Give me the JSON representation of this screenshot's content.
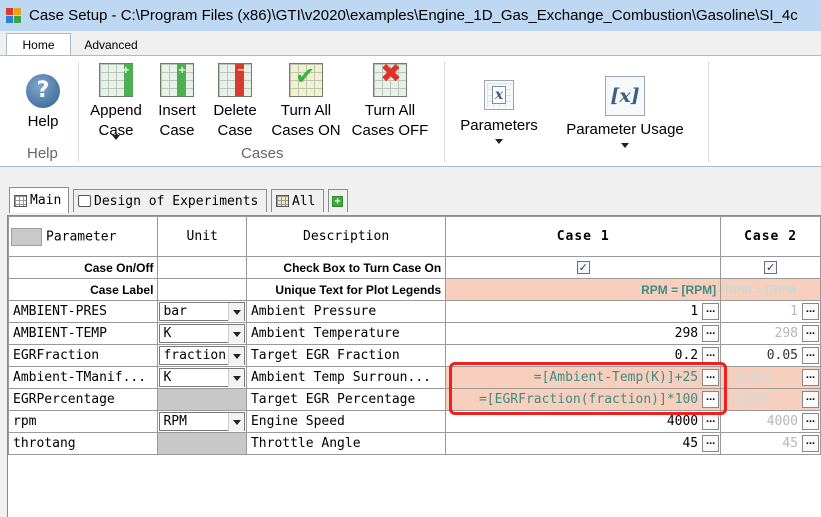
{
  "window": {
    "title": "Case Setup - C:\\Program Files (x86)\\GTI\\v2020\\examples\\Engine_1D_Gas_Exchange_Combustion\\Gasoline\\SI_4c"
  },
  "ribbon_tabs": [
    "Home",
    "Advanced"
  ],
  "ribbon": {
    "help": {
      "label": "Help",
      "group": "Help"
    },
    "cases_group": "Cases",
    "append_case": [
      "Append",
      "Case"
    ],
    "insert_case": [
      "Insert",
      "Case"
    ],
    "delete_case": [
      "Delete",
      "Case"
    ],
    "turn_all_on": [
      "Turn All",
      "Cases ON"
    ],
    "turn_all_off": [
      "Turn All",
      "Cases OFF"
    ],
    "parameters": "Parameters",
    "parameter_usage": "Parameter Usage"
  },
  "sheet_tabs": [
    "Main",
    "Design of Experiments",
    "All"
  ],
  "grid": {
    "headers": {
      "parameter": "Parameter",
      "unit": "Unit",
      "description": "Description",
      "case1": "Case 1",
      "case2": "Case 2"
    },
    "case_on_off": {
      "label": "Case On/Off",
      "description": "Check Box to Turn Case On",
      "case1_checked": true,
      "case2_checked": true
    },
    "case_label": {
      "label": "Case Label",
      "description": "Unique Text for Plot Legends",
      "case1": "RPM = [RPM]",
      "case2": "RPM = [RPM"
    },
    "rows": [
      {
        "param": "AMBIENT-PRES",
        "unit": "bar",
        "desc": "Ambient Pressure",
        "c1": "1",
        "c2": "1"
      },
      {
        "param": "AMBIENT-TEMP",
        "unit": "K",
        "desc": "Ambient Temperature",
        "c1": "298",
        "c2": "298"
      },
      {
        "param": "EGRFraction",
        "unit": "fraction",
        "desc": "Target EGR Fraction",
        "c1": "0.2",
        "c2": "0.05"
      },
      {
        "param": "Ambient-TManif...",
        "unit": "K",
        "desc": "Ambient Temp Surroun...",
        "c1": "=[Ambient-Temp(K)]+25",
        "c2": "=[Ambi..."
      },
      {
        "param": "EGRPercentage",
        "unit": "",
        "desc": "Target EGR Percentage",
        "c1": "=[EGRFraction(fraction)]*100",
        "c2": "=[EGRF..."
      },
      {
        "param": "rpm",
        "unit": "RPM",
        "desc": "Engine Speed",
        "c1": "4000",
        "c2": "4000"
      },
      {
        "param": "throtang",
        "unit": "",
        "desc": "Throttle Angle",
        "c1": "45",
        "c2": "45"
      }
    ],
    "ellipsis": "..."
  },
  "colors": {
    "titlebar": "#bed7f3",
    "case_label_bg": "#f8cfbd",
    "case_label_text": "#3c8c86",
    "highlight": "#f02020"
  }
}
